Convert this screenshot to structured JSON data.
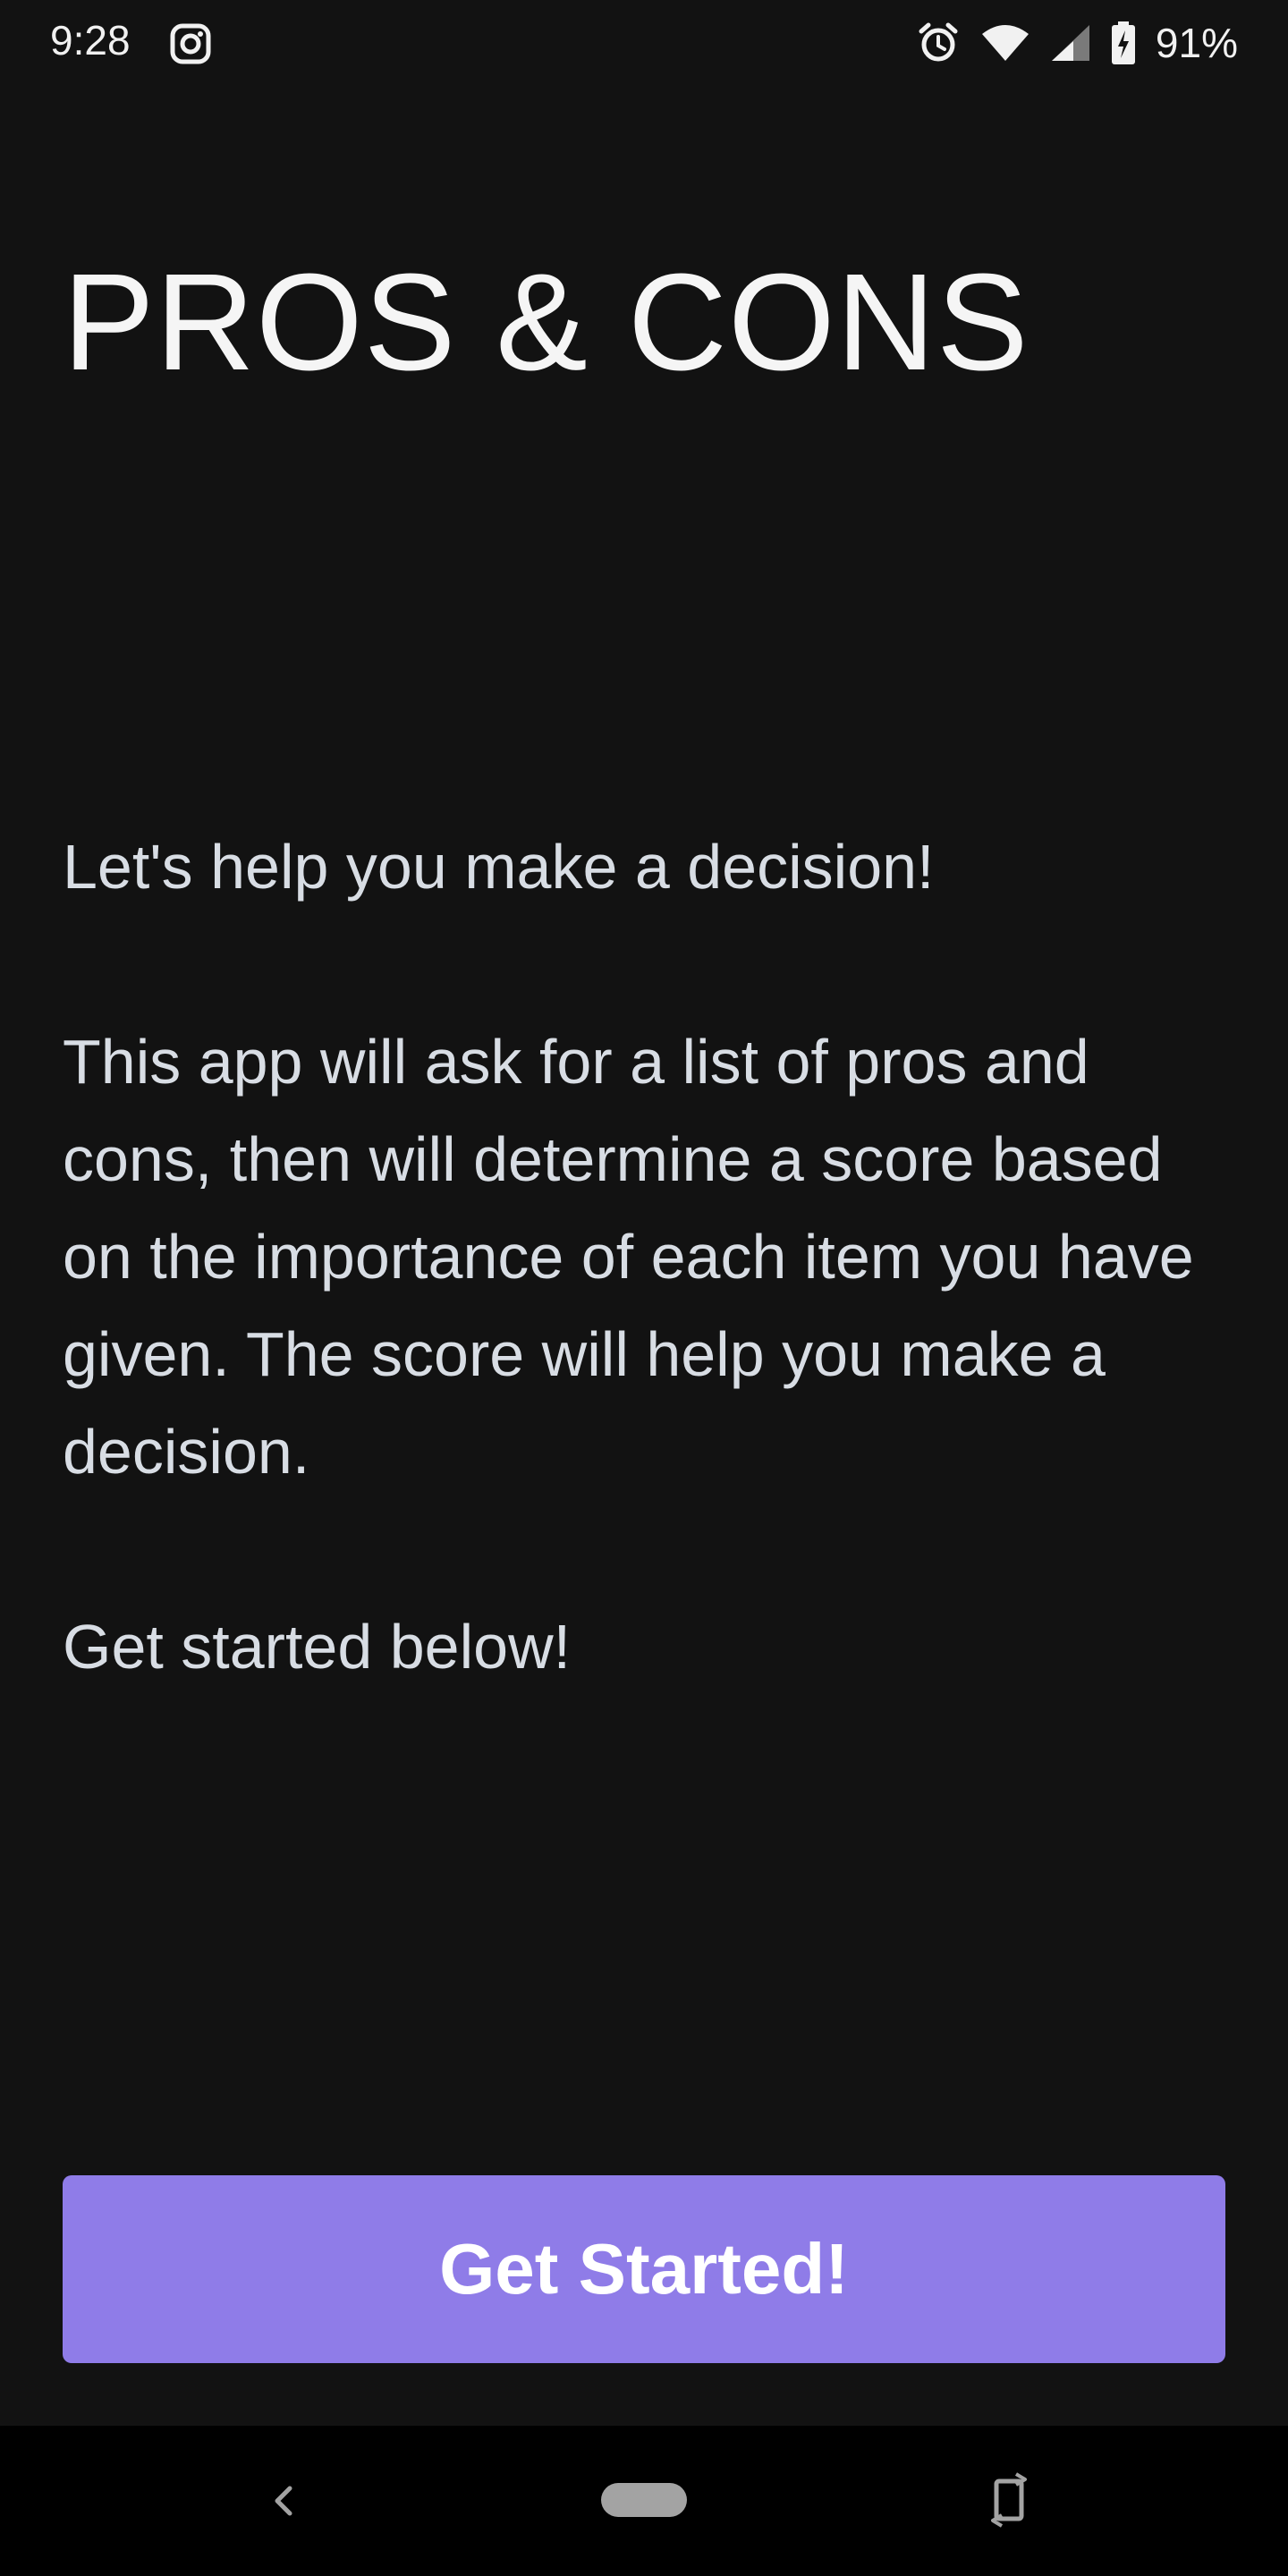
{
  "status_bar": {
    "time": "9:28",
    "left_icon": "instagram-icon",
    "right_icons": [
      "alarm-icon",
      "wifi-icon",
      "cellular-signal-icon",
      "battery-charging-icon"
    ],
    "battery_percent": "91%"
  },
  "app": {
    "title": "PROS & CONS"
  },
  "intro": {
    "headline": "Let's help you make a decision!",
    "description": "This app will ask for a list of pros and cons, then will determine a score based on the importance of each item you have given. The score will help you make a decision.",
    "prompt": "Get started below!"
  },
  "cta": {
    "label": "Get Started!",
    "color": "#8f7ce8"
  },
  "nav_bar": {
    "icons": [
      "back-icon",
      "home-pill-icon",
      "rotate-icon"
    ]
  },
  "colors": {
    "background": "#121212",
    "text": "#d8dde4",
    "accent": "#8f7ce8"
  }
}
